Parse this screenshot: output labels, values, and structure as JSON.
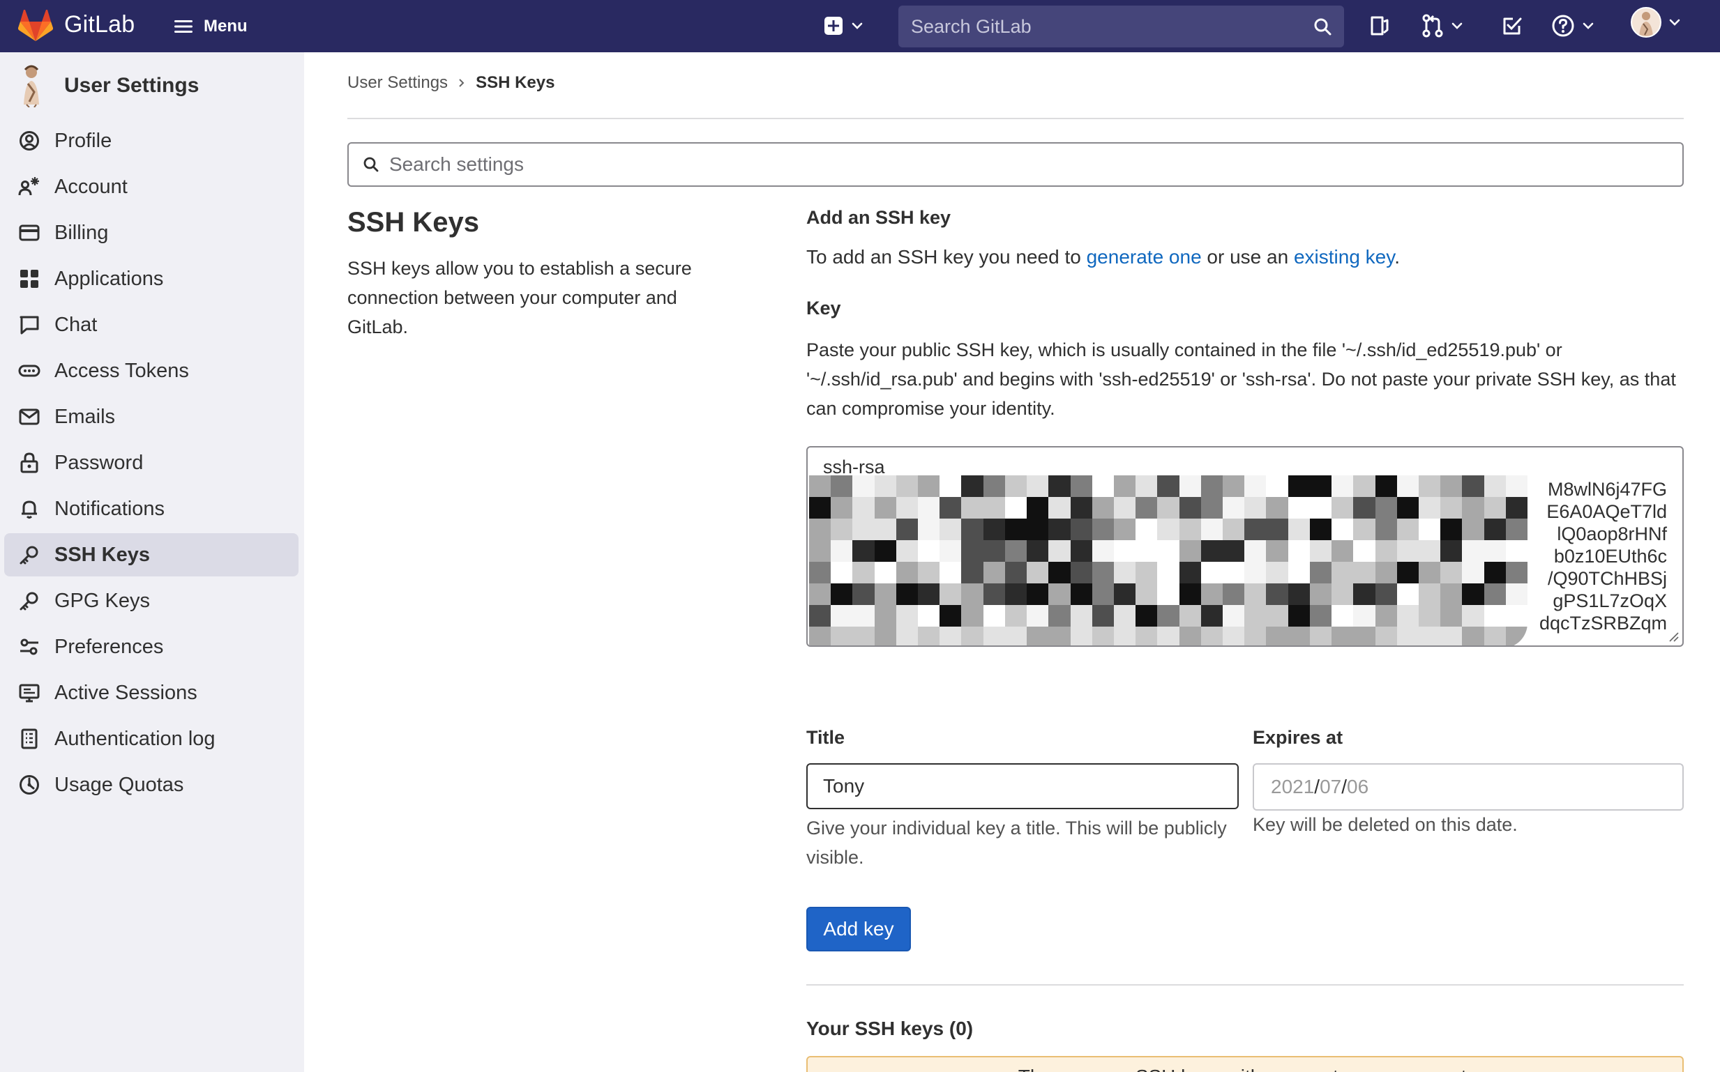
{
  "topbar": {
    "brand": "GitLab",
    "menu_label": "Menu",
    "search_placeholder": "Search GitLab"
  },
  "sidebar": {
    "title": "User Settings",
    "items": [
      {
        "label": "Profile",
        "icon": "profile-icon",
        "active": false
      },
      {
        "label": "Account",
        "icon": "account-icon",
        "active": false
      },
      {
        "label": "Billing",
        "icon": "billing-icon",
        "active": false
      },
      {
        "label": "Applications",
        "icon": "applications-icon",
        "active": false
      },
      {
        "label": "Chat",
        "icon": "chat-icon",
        "active": false
      },
      {
        "label": "Access Tokens",
        "icon": "token-icon",
        "active": false
      },
      {
        "label": "Emails",
        "icon": "mail-icon",
        "active": false
      },
      {
        "label": "Password",
        "icon": "lock-icon",
        "active": false
      },
      {
        "label": "Notifications",
        "icon": "bell-icon",
        "active": false
      },
      {
        "label": "SSH Keys",
        "icon": "key-icon",
        "active": true
      },
      {
        "label": "GPG Keys",
        "icon": "key-icon",
        "active": false
      },
      {
        "label": "Preferences",
        "icon": "preferences-icon",
        "active": false
      },
      {
        "label": "Active Sessions",
        "icon": "monitor-icon",
        "active": false
      },
      {
        "label": "Authentication log",
        "icon": "log-icon",
        "active": false
      },
      {
        "label": "Usage Quotas",
        "icon": "quota-icon",
        "active": false
      }
    ]
  },
  "breadcrumb": {
    "parent": "User Settings",
    "current": "SSH Keys"
  },
  "settings_search": {
    "placeholder": "Search settings"
  },
  "intro": {
    "heading": "SSH Keys",
    "description": "SSH keys allow you to establish a secure connection between your computer and GitLab."
  },
  "add_key": {
    "heading": "Add an SSH key",
    "intro_prefix": "To add an SSH key you need to ",
    "link_generate": "generate one",
    "intro_middle": " or use an ",
    "link_existing": "existing key",
    "intro_suffix": ".",
    "key_label": "Key",
    "key_help": "Paste your public SSH key, which is usually contained in the file '~/.ssh/id_ed25519.pub' or '~/.ssh/id_rsa.pub' and begins with 'ssh-ed25519' or 'ssh-rsa'. Do not paste your private SSH key, as that can compromise your identity.",
    "key_value_visible_first_line": "ssh-rsa",
    "key_value_visible_tail": [
      "M8wlN6j47FG",
      "E6A0AQeT7ld",
      "lQ0aop8rHNf",
      "b0z10EUth6c",
      "/Q90TChHBSj",
      "gPS1L7zOqX",
      "dqcTzSRBZqm"
    ],
    "title_label": "Title",
    "title_value": "Tony",
    "title_help": "Give your individual key a title. This will be publicly visible.",
    "expires_label": "Expires at",
    "expires_year": "2021",
    "expires_month": "07",
    "expires_day": "06",
    "expires_help": "Key will be deleted on this date.",
    "submit_label": "Add key"
  },
  "your_keys": {
    "heading": "Your SSH keys (0)",
    "empty_message": "There are no SSH keys with access to your account."
  },
  "colors": {
    "topbar": "#292961",
    "sidebar": "#f0f0f5",
    "primary_button": "#1f64c7",
    "link": "#1068bf",
    "warning_bg": "#fdf1dd"
  }
}
